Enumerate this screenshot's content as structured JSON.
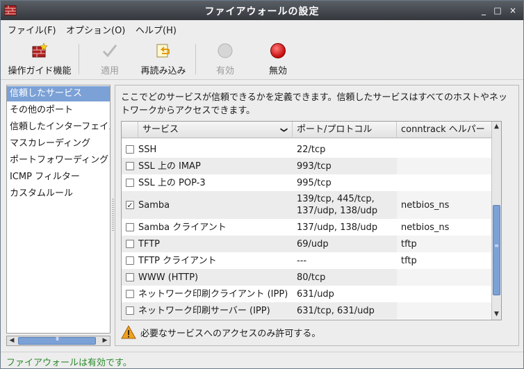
{
  "window": {
    "title": "ファイアウォールの設定",
    "controls": [
      "_",
      "□",
      "×"
    ]
  },
  "menu": [
    {
      "label": "ファイル(F)"
    },
    {
      "label": "オプション(O)"
    },
    {
      "label": "ヘルプ(H)"
    }
  ],
  "toolbar": {
    "wizard_label": "操作ガイド機能",
    "apply_label": "適用",
    "reload_label": "再読み込み",
    "enable_label": "有効",
    "disable_label": "無効"
  },
  "sidebar": {
    "items": [
      {
        "label": "信頼したサービス"
      },
      {
        "label": "その他のポート"
      },
      {
        "label": "信頼したインターフェイス"
      },
      {
        "label": "マスカレーディング"
      },
      {
        "label": "ポートフォワーディング"
      },
      {
        "label": "ICMP フィルター"
      },
      {
        "label": "カスタムルール"
      }
    ],
    "selected_index": 0,
    "hscroll_grip": "III"
  },
  "main": {
    "description": "ここでどのサービスが信頼できるかを定義できます。信頼したサービスはすべてのホストやネットワークからアクセスできます。",
    "columns": [
      "サービス",
      "ポート/プロトコル",
      "conntrack ヘルパー"
    ],
    "sort_indicator": "❯",
    "rows": [
      {
        "service": "SSH",
        "ports": "22/tcp",
        "helper": "",
        "checked": false
      },
      {
        "service": "SSL 上の IMAP",
        "ports": "993/tcp",
        "helper": "",
        "checked": false
      },
      {
        "service": "SSL 上の POP-3",
        "ports": "995/tcp",
        "helper": "",
        "checked": false
      },
      {
        "service": "Samba",
        "ports": "139/tcp, 445/tcp,\n137/udp, 138/udp",
        "helper": "netbios_ns",
        "checked": true
      },
      {
        "service": "Samba クライアント",
        "ports": "137/udp, 138/udp",
        "helper": "netbios_ns",
        "checked": false
      },
      {
        "service": "TFTP",
        "ports": "69/udp",
        "helper": "tftp",
        "checked": false
      },
      {
        "service": "TFTP クライアント",
        "ports": "---",
        "helper": "tftp",
        "checked": false
      },
      {
        "service": "WWW (HTTP)",
        "ports": "80/tcp",
        "helper": "",
        "checked": false
      },
      {
        "service": "ネットワーク印刷クライアント (IPP)",
        "ports": "631/udp",
        "helper": "",
        "checked": false
      },
      {
        "service": "ネットワーク印刷サーバー (IPP)",
        "ports": "631/tcp, 631/udp",
        "helper": "",
        "checked": false
      }
    ],
    "warning": "必要なサービスへのアクセスのみ許可する。",
    "scroll_grip": "≡"
  },
  "status": {
    "text": "ファイアウォールは有効です。",
    "color": "#2a8a2a"
  },
  "colors": {
    "selection": "#7ba1d6",
    "titlebar": "#3f4449",
    "warning": "#f0a020",
    "disable_red": "#d00000"
  }
}
